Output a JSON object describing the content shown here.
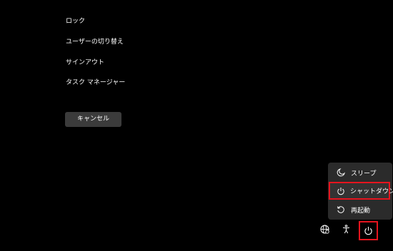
{
  "security_options": {
    "items": [
      {
        "label": "ロック"
      },
      {
        "label": "ユーザーの切り替え"
      },
      {
        "label": "サインアウト"
      },
      {
        "label": "タスク マネージャー"
      }
    ],
    "cancel_label": "キャンセル"
  },
  "power_menu": {
    "items": [
      {
        "label": "スリープ",
        "icon": "moon-icon"
      },
      {
        "label": "シャットダウン",
        "icon": "power-icon",
        "highlighted": true
      },
      {
        "label": "再起動",
        "icon": "restart-icon"
      }
    ]
  },
  "tray": {
    "icons": [
      "network-icon",
      "accessibility-icon",
      "power-icon"
    ]
  },
  "colors": {
    "background": "#000000",
    "button_bg": "#3b3b3b",
    "menu_bg": "#2b2b2b",
    "highlight_border": "#e6141e",
    "text": "#ffffff"
  }
}
